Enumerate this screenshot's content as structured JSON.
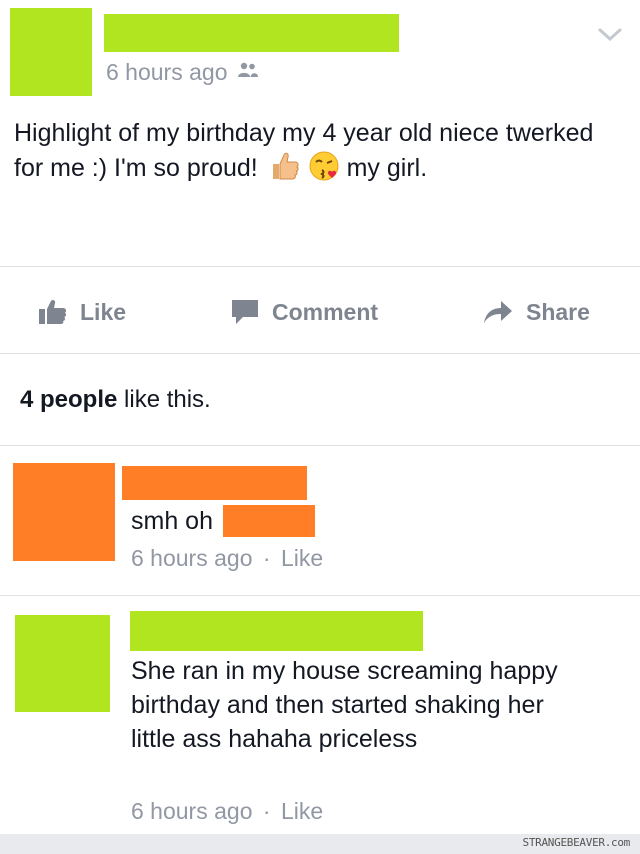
{
  "post": {
    "timestamp": "6 hours ago",
    "audience_icon": "friends-icon",
    "text_part1": "Highlight of my birthday my 4 year old niece twerked for me :) I'm so proud!",
    "text_part2": "my girl.",
    "emoji": [
      "thumbs-up-emoji",
      "kissing-face-emoji"
    ],
    "chevron_icon": "chevron-down-icon"
  },
  "actions": {
    "like": "Like",
    "comment": "Comment",
    "share": "Share"
  },
  "likes": {
    "count": "4 people",
    "suffix": " like this."
  },
  "comments": [
    {
      "text": "smh oh",
      "timestamp": "6 hours ago",
      "separator": "·",
      "like_label": "Like"
    },
    {
      "text": "She ran in my house screaming happy birthday and then started shaking her little ass hahaha priceless",
      "timestamp": "6 hours ago",
      "separator": "·",
      "like_label": "Like"
    }
  ],
  "watermark": "STRANGEBEAVER.com",
  "colors": {
    "redact_green": "#b1e51f",
    "redact_orange": "#ff7e26",
    "meta_gray": "#9197a3",
    "action_gray": "#7f8590"
  }
}
